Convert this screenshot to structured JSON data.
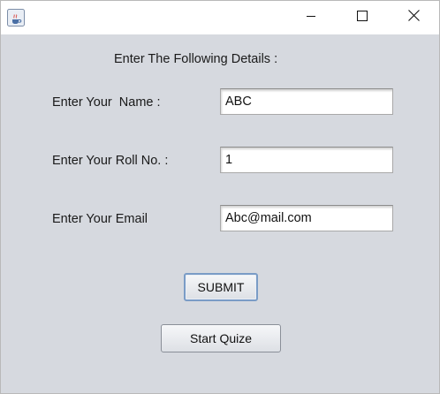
{
  "window": {
    "icon": "java-cup-icon",
    "controls": {
      "minimize": "minimize-icon",
      "maximize": "maximize-icon",
      "close": "close-icon"
    }
  },
  "form": {
    "heading": "Enter The Following Details :",
    "name_label": "Enter Your  Name :",
    "name_value": "ABC",
    "roll_label": "Enter Your Roll No. :",
    "roll_value": "1",
    "email_label": "Enter Your Email",
    "email_value": "Abc@mail.com",
    "submit_label": "SUBMIT",
    "start_label": "Start Quize"
  },
  "colors": {
    "background": "#d6d9df",
    "titlebar": "#ffffff",
    "focus_border": "#7a9cc6"
  }
}
